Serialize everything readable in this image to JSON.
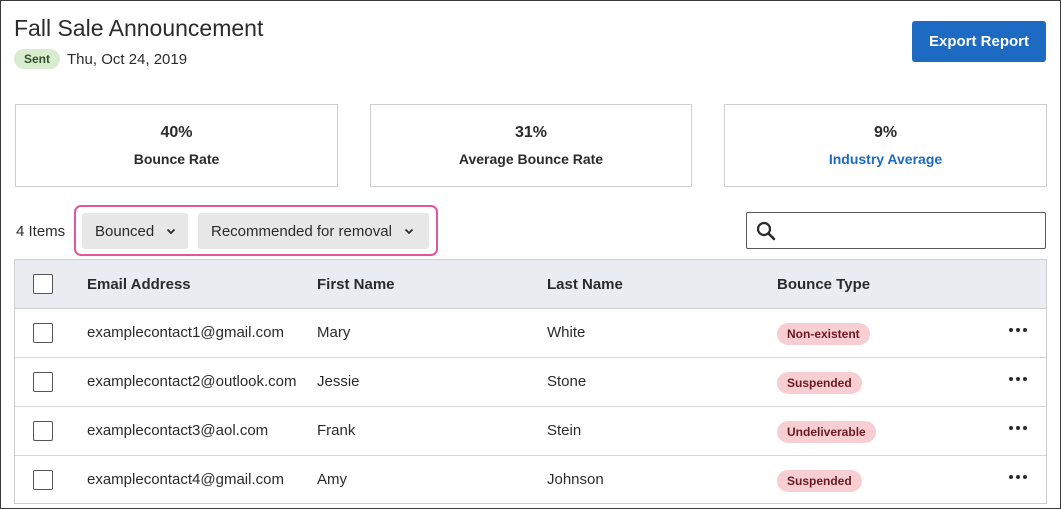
{
  "header": {
    "title": "Fall Sale Announcement",
    "status_badge": "Sent",
    "date": "Thu, Oct 24, 2019",
    "export_label": "Export Report"
  },
  "stats": [
    {
      "value": "40%",
      "label": "Bounce Rate"
    },
    {
      "value": "31%",
      "label": "Average Bounce Rate"
    },
    {
      "value": "9%",
      "label": "Industry Average"
    }
  ],
  "toolbar": {
    "items_count": "4 Items",
    "filter_status": "Bounced",
    "filter_recommend": "Recommended for removal",
    "search_value": "",
    "search_icon": "search-icon"
  },
  "table": {
    "columns": [
      "Email Address",
      "First Name",
      "Last Name",
      "Bounce Type"
    ],
    "rows": [
      {
        "email": "examplecontact1@gmail.com",
        "first": "Mary",
        "last": "White",
        "bounce": "Non-existent"
      },
      {
        "email": "examplecontact2@outlook.com",
        "first": "Jessie",
        "last": "Stone",
        "bounce": "Suspended"
      },
      {
        "email": "examplecontact3@aol.com",
        "first": "Frank",
        "last": "Stein",
        "bounce": "Undeliverable"
      },
      {
        "email": "examplecontact4@gmail.com",
        "first": "Amy",
        "last": "Johnson",
        "bounce": "Suspended"
      }
    ]
  },
  "colors": {
    "accent": "#1d6ac2",
    "sent_badge_bg": "#d8eccf",
    "bounce_badge_bg": "#f7cfd3",
    "filter_highlight": "#e2579b"
  }
}
